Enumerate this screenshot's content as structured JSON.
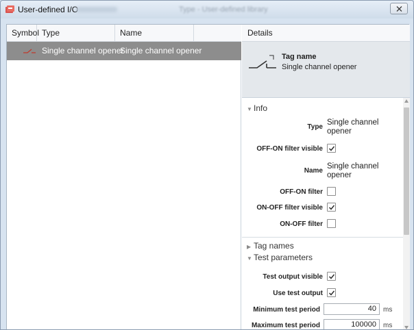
{
  "window": {
    "title": "User-defined I/O",
    "subtitle_blurred": "Type - User-defined library",
    "close_glyph": "✕"
  },
  "table": {
    "columns": [
      "Symbol",
      "Type",
      "Name",
      ""
    ],
    "rows": [
      {
        "symbol_icon": "switch-opener-icon",
        "type": "Single channel opener",
        "name": "Single channel opener"
      }
    ]
  },
  "details": {
    "header": "Details",
    "tag_label": "Tag name",
    "tag_value": "Single channel opener",
    "sections": {
      "info": "Info",
      "tag_names": "Tag names",
      "test_parameters": "Test parameters"
    },
    "info": {
      "type_label": "Type",
      "type_value": "Single channel opener",
      "off_on_filter_visible_label": "OFF-ON filter visible",
      "off_on_filter_visible": true,
      "name_label": "Name",
      "name_value": "Single channel opener",
      "off_on_filter_label": "OFF-ON filter",
      "off_on_filter": false,
      "on_off_filter_visible_label": "ON-OFF filter visible",
      "on_off_filter_visible": true,
      "on_off_filter_label": "ON-OFF filter",
      "on_off_filter": false
    },
    "test": {
      "test_output_visible_label": "Test output visible",
      "test_output_visible": true,
      "use_test_output_label": "Use test output",
      "use_test_output": true,
      "min_period_label": "Minimum test period",
      "min_period_value": "40",
      "max_period_label": "Maximum test period",
      "max_period_value": "100000",
      "unit": "ms"
    }
  },
  "colors": {
    "selected_row": "#8d8d8d",
    "accent_icon": "#c0392b"
  }
}
